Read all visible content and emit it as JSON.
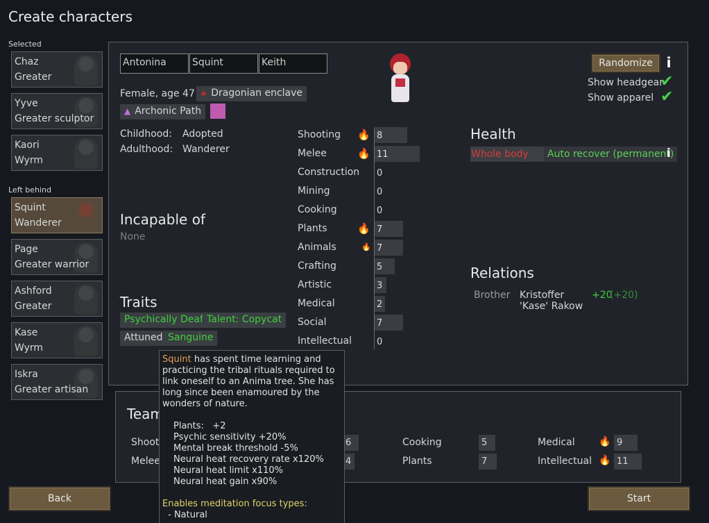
{
  "window": {
    "title": "Create characters"
  },
  "sidebar": {
    "selected_label": "Selected",
    "left_behind_label": "Left behind",
    "selected": [
      {
        "name": "Chaz",
        "title": "Greater"
      },
      {
        "name": "Yyve",
        "title": "Greater sculptor"
      },
      {
        "name": "Kaori",
        "title": "Wyrm"
      }
    ],
    "left_behind": [
      {
        "name": "Squint",
        "title": "Wanderer"
      },
      {
        "name": "Page",
        "title": "Greater warrior"
      },
      {
        "name": "Ashford",
        "title": "Greater"
      },
      {
        "name": "Kase",
        "title": "Wyrm"
      },
      {
        "name": "Iskra",
        "title": "Greater artisan"
      }
    ]
  },
  "character": {
    "first_name": "Antonina",
    "nick_name": "Squint",
    "last_name": "Keith",
    "gender_age": "Female, age 47",
    "faction": "Dragonian enclave",
    "ideology": "Archonic Path",
    "childhood_label": "Childhood:",
    "childhood": "Adopted",
    "adulthood_label": "Adulthood:",
    "adulthood": "Wanderer",
    "incapable_title": "Incapable of",
    "incapable_value": "None",
    "traits_title": "Traits",
    "traits": [
      "Psychically Deaf",
      "Talent: Copycat",
      "Attuned",
      "Sanguine"
    ]
  },
  "skills": [
    {
      "name": "Shooting",
      "value": "8",
      "passion": 2,
      "level": 8
    },
    {
      "name": "Melee",
      "value": "11",
      "passion": 2,
      "level": 11
    },
    {
      "name": "Construction",
      "value": "0",
      "passion": 0,
      "level": 0
    },
    {
      "name": "Mining",
      "value": "0",
      "passion": 0,
      "level": 0
    },
    {
      "name": "Cooking",
      "value": "0",
      "passion": 0,
      "level": 0
    },
    {
      "name": "Plants",
      "value": "7",
      "passion": 2,
      "level": 7
    },
    {
      "name": "Animals",
      "value": "7",
      "passion": 1,
      "level": 7
    },
    {
      "name": "Crafting",
      "value": "5",
      "passion": 0,
      "level": 5
    },
    {
      "name": "Artistic",
      "value": "3",
      "passion": 0,
      "level": 3
    },
    {
      "name": "Medical",
      "value": "2",
      "passion": 0,
      "level": 2
    },
    {
      "name": "Social",
      "value": "7",
      "passion": 0,
      "level": 7
    },
    {
      "name": "Intellectual",
      "value": "0",
      "passion": 0,
      "level": 0
    }
  ],
  "controls": {
    "randomize": "Randomize",
    "show_headgear": "Show headgear",
    "show_apparel": "Show apparel",
    "back": "Back",
    "start": "Start"
  },
  "health": {
    "title": "Health",
    "part": "Whole body",
    "condition": "Auto recover (permanent)"
  },
  "relations": {
    "title": "Relations",
    "items": [
      {
        "relation": "Brother",
        "name": "Kristoffer 'Kase' Rakow",
        "opinion": "+20",
        "opinion_other": "(+20)"
      }
    ]
  },
  "team": {
    "title": "Team",
    "cells": [
      {
        "name": "Shooti",
        "value": "6",
        "passion": 0
      },
      {
        "name": "Melee",
        "value": "4",
        "passion": 0
      },
      {
        "name": "Cooking",
        "value": "5",
        "passion": 0
      },
      {
        "name": "Plants",
        "value": "7",
        "passion": 0
      },
      {
        "name": "Medical",
        "value": "9",
        "passion": 2
      },
      {
        "name": "Intellectual",
        "value": "11",
        "passion": 2
      }
    ]
  },
  "tooltip": {
    "name": "Squint",
    "desc": " has spent time learning and practicing the tribal rituals required to link oneself to an Anima tree. She has long since been enamoured by the wonders of nature.",
    "effects": [
      "Plants:   +2",
      "Psychic sensitivity +20%",
      "Mental break threshold -5%",
      "Neural heat recovery rate x120%",
      "Neural heat limit x110%",
      "Neural heat gain x90%"
    ],
    "focus_title": "Enables meditation focus types:",
    "focus_item": " - Natural"
  },
  "colors": {
    "accent_green": "#3fd03f",
    "health_red": "#d93b3b",
    "ideology_pink": "#c05ab0",
    "button_brown": "#6b5a3e"
  }
}
